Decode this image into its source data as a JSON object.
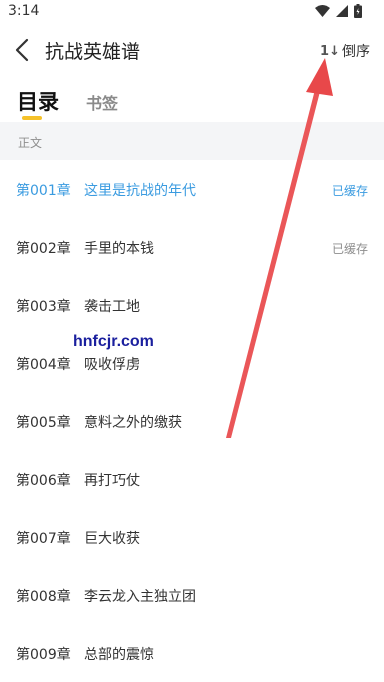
{
  "status_bar": {
    "time": "3:14"
  },
  "header": {
    "title": "抗战英雄谱",
    "sort_label": "倒序",
    "sort_icon": "1↓"
  },
  "tabs": [
    {
      "label": "目录"
    },
    {
      "label": "书签"
    }
  ],
  "section": {
    "label": "正文"
  },
  "chapters": [
    {
      "num": "第001章",
      "title": "这里是抗战的年代",
      "cache": "已缓存"
    },
    {
      "num": "第002章",
      "title": "手里的本钱",
      "cache": "已缓存"
    },
    {
      "num": "第003章",
      "title": "袭击工地",
      "cache": ""
    },
    {
      "num": "第004章",
      "title": "吸收俘虏",
      "cache": ""
    },
    {
      "num": "第005章",
      "title": "意料之外的缴获",
      "cache": ""
    },
    {
      "num": "第006章",
      "title": "再打巧仗",
      "cache": ""
    },
    {
      "num": "第007章",
      "title": "巨大收获",
      "cache": ""
    },
    {
      "num": "第008章",
      "title": "李云龙入主独立团",
      "cache": ""
    },
    {
      "num": "第009章",
      "title": "总部的震惊",
      "cache": ""
    }
  ],
  "watermark": "hnfcjr.com",
  "colors": {
    "accent": "#3a9be0",
    "tab_indicator": "#f6c22a",
    "annotation_arrow": "#e8484a"
  }
}
